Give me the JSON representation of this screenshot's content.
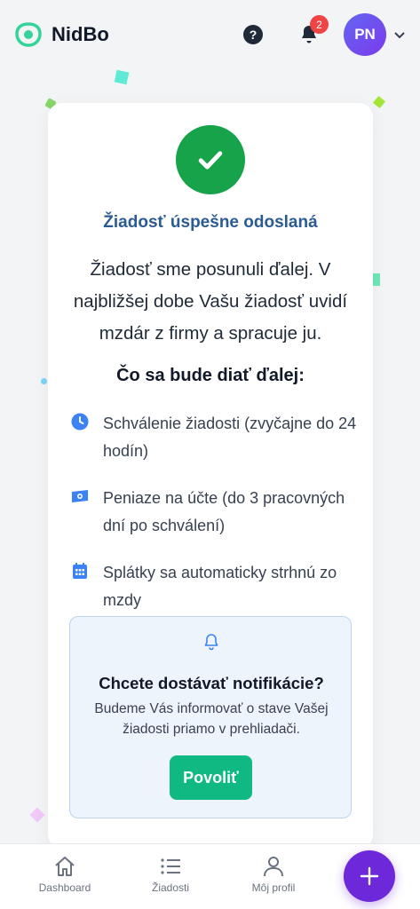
{
  "app": {
    "name": "NidBo",
    "logo_icon": "nidbo-logo-icon"
  },
  "header": {
    "help_icon": "question-circle-icon",
    "notifications": {
      "icon": "bell-icon",
      "count": "2"
    },
    "user": {
      "initials": "PN"
    }
  },
  "colors": {
    "brand_green": "#16a34a",
    "accent_green": "#10b981",
    "title_blue": "#2b5b93",
    "icon_blue": "#3b82f6",
    "primary_purple": "#6d28d9",
    "badge_red": "#ef4444"
  },
  "success": {
    "icon": "check-icon",
    "title": "Žiadosť úspešne odoslaná",
    "body": "Žiadosť sme posunuli ďalej. V najbližšej dobe Vašu žiadosť uvidí mzdár z firmy a spracuje ju."
  },
  "next_steps": {
    "title": "Čo sa bude diať ďalej:",
    "items": [
      {
        "icon": "clock-icon",
        "label": "Schválenie žiadosti (zvyčajne do 24 hodín)"
      },
      {
        "icon": "money-icon",
        "label": "Peniaze na účte (do 3 pracovných dní po schválení)"
      },
      {
        "icon": "calendar-icon",
        "label": "Splátky sa automaticky strhnú zo mzdy"
      }
    ]
  },
  "notifications_prompt": {
    "icon": "bell-outline-icon",
    "title": "Chcete dostávať notifikácie?",
    "text": "Budeme Vás informovať o stave Vašej žiadosti priamo v prehliadači.",
    "button_label": "Povoliť"
  },
  "bottom_nav": {
    "items": [
      {
        "icon": "home-icon",
        "label": "Dashboard"
      },
      {
        "icon": "list-icon",
        "label": "Žiadosti"
      },
      {
        "icon": "user-icon",
        "label": "Môj profil"
      }
    ],
    "fab_icon": "plus-icon"
  }
}
